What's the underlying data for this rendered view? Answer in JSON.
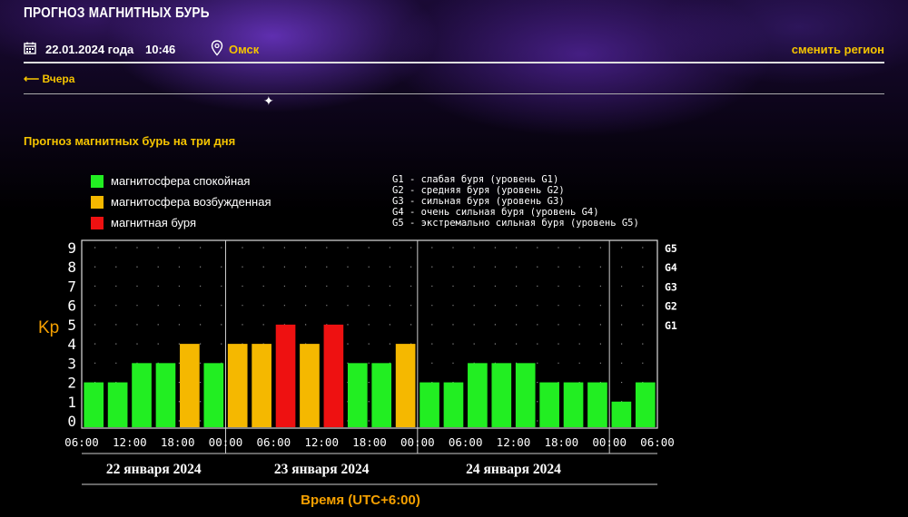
{
  "page": {
    "title": "ПРОГНОЗ МАГНИТНЫХ БУРЬ",
    "date": "22.01.2024 года",
    "time": "10:46",
    "city": "Омск",
    "change_region": "сменить регион",
    "back_link": "⟵ Вчера",
    "subtitle": "Прогноз магнитных бурь на три дня"
  },
  "legend": {
    "items": [
      {
        "label": "магнитосфера спокойная",
        "color": "#22ee22"
      },
      {
        "label": "магнитосфера возбужденная",
        "color": "#f5b800"
      },
      {
        "label": "магнитная буря",
        "color": "#ee1111"
      }
    ],
    "storm_levels": [
      "G1 - слабая буря (уровень G1)",
      "G2 - средняя буря (уровень G2)",
      "G3 - сильная буря (уровень G3)",
      "G4 - очень сильная буря (уровень G4)",
      "G5 - экстремально сильная буря (уровень G5)"
    ]
  },
  "chart_data": {
    "type": "bar",
    "ylabel": "Kp",
    "xlabel": "Время (UTC+6:00)",
    "ylim": [
      0,
      9
    ],
    "y_ticks": [
      0,
      1,
      2,
      3,
      4,
      5,
      6,
      7,
      8,
      9
    ],
    "right_ticks": [
      {
        "label": "G1",
        "value": 5
      },
      {
        "label": "G2",
        "value": 6
      },
      {
        "label": "G3",
        "value": 7
      },
      {
        "label": "G4",
        "value": 8
      },
      {
        "label": "G5",
        "value": 9
      }
    ],
    "x_tick_labels": [
      "06:00",
      "12:00",
      "18:00",
      "00:00",
      "06:00",
      "12:00",
      "18:00",
      "00:00",
      "06:00",
      "12:00",
      "18:00",
      "00:00",
      "06:00"
    ],
    "days": [
      "22 января 2024",
      "23 января 2024",
      "24 января 2024"
    ],
    "values": [
      2,
      2,
      3,
      3,
      4,
      3,
      4,
      4,
      5,
      4,
      5,
      3,
      3,
      4,
      2,
      2,
      3,
      3,
      3,
      2,
      2,
      2,
      1,
      2
    ],
    "levels": [
      "calm",
      "calm",
      "calm",
      "calm",
      "excited",
      "calm",
      "excited",
      "excited",
      "storm",
      "excited",
      "storm",
      "calm",
      "calm",
      "excited",
      "calm",
      "calm",
      "calm",
      "calm",
      "calm",
      "calm",
      "calm",
      "calm",
      "calm",
      "calm"
    ],
    "colors": {
      "calm": "#22ee22",
      "excited": "#f5b800",
      "storm": "#ee1111",
      "tick": "#fff",
      "day_label": "#fff",
      "axis_title": "#f5a000"
    },
    "grid": true
  }
}
